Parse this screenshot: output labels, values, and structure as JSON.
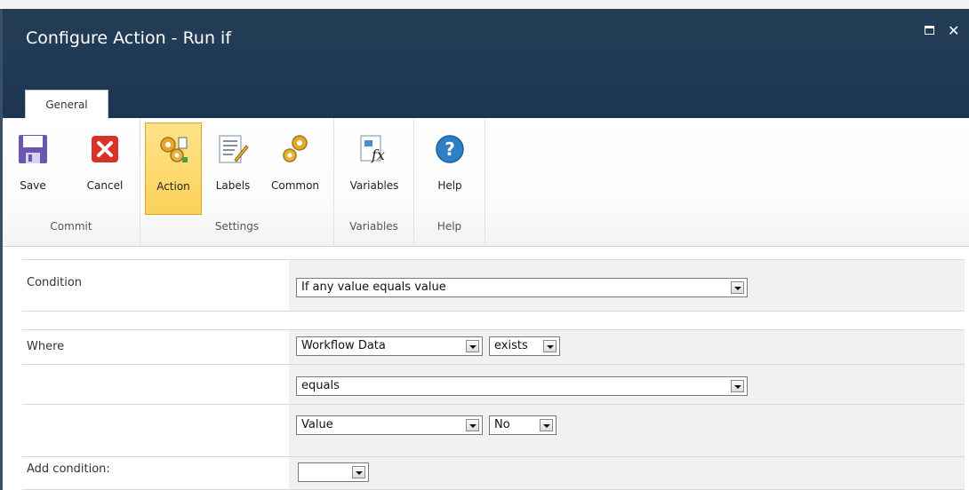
{
  "window": {
    "title": "Configure Action - Run if"
  },
  "ribbon": {
    "tab": "General",
    "groups": [
      {
        "label": "Commit",
        "buttons": [
          {
            "label": "Save",
            "icon": "save-icon"
          },
          {
            "label": "Cancel",
            "icon": "cancel-icon"
          }
        ]
      },
      {
        "label": "Settings",
        "buttons": [
          {
            "label": "Action",
            "icon": "action-gears-icon",
            "active": true
          },
          {
            "label": "Labels",
            "icon": "labels-icon"
          },
          {
            "label": "Common",
            "icon": "common-gears-icon"
          }
        ]
      },
      {
        "label": "Variables",
        "buttons": [
          {
            "label": "Variables",
            "icon": "variables-fx-icon"
          }
        ]
      },
      {
        "label": "Help",
        "buttons": [
          {
            "label": "Help",
            "icon": "help-icon"
          }
        ]
      }
    ]
  },
  "form": {
    "condition": {
      "label": "Condition",
      "value": "If any value equals value"
    },
    "where": {
      "label": "Where",
      "source": "Workflow Data",
      "exists": "exists",
      "operator": "equals",
      "value_type": "Value",
      "value": "No"
    },
    "add_condition": {
      "label": "Add condition:",
      "value": ""
    }
  },
  "colors": {
    "titlebar": "#1f3a55",
    "active_button": "#fcd15a"
  }
}
